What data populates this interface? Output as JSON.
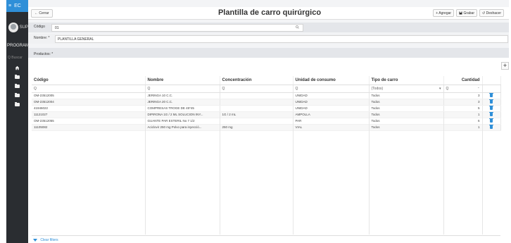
{
  "sidebar": {
    "menu_glyph": "≡",
    "brand": "EC",
    "user_name": "SUP",
    "program": "PROGRAM",
    "search_placeholder": "Q Buscar",
    "home_icon": "home-icon",
    "folder_icon": "folder-icon"
  },
  "header": {
    "back_label": "← Cerrar",
    "title": "Plantilla de carro quirúrgico",
    "add_label": "+ Agregar",
    "save_label": "Grabar",
    "undo_label": "Deshacer"
  },
  "form": {
    "code_label": "Código",
    "code_value": "01",
    "name_label": "Nombre: *",
    "name_value": "PLANTILLA GENERAL",
    "products_label": "Productos: *"
  },
  "grid": {
    "add_button": "+",
    "columns": [
      "Código",
      "Nombre",
      "Concentración",
      "Unidad de consumo",
      "Tipo de carro",
      "Cantidad"
    ],
    "filter": {
      "search_glyph": "Q",
      "tipo_value": "(Todos)",
      "tipo_caret": "▾",
      "spin_glyph": "⌃"
    },
    "rows": [
      {
        "codigo": "OM-23512005",
        "nombre": "JERINGA 10 C.C.",
        "concentracion": "",
        "unidad": "UNIDAD",
        "tipo": "Todos",
        "cantidad": "3"
      },
      {
        "codigo": "OM-23512004",
        "nombre": "JERINGA 20 C.C.",
        "concentracion": "",
        "unidad": "UNIDAD",
        "tipo": "Todos",
        "cantidad": "3"
      },
      {
        "codigo": "41946022",
        "nombre": "COMPRESAS TROGE DE 45*45",
        "concentracion": "",
        "unidad": "UNIDAD",
        "tipo": "Todos",
        "cantidad": "5"
      },
      {
        "codigo": "11121027",
        "nombre": "DIPIRONA 1G / 2 ML SOLUCION INY...",
        "concentracion": "1G / 2 mL",
        "unidad": "AMPOLLA",
        "tipo": "Todos",
        "cantidad": "1"
      },
      {
        "codigo": "OM-23512055",
        "nombre": "GUANTE PAR ESTERIL No 7 1/2",
        "concentracion": "",
        "unidad": "PAR",
        "tipo": "Todos",
        "cantidad": "6"
      },
      {
        "codigo": "11105082",
        "nombre": "Aciclovir 250 mg Polvo para inyecció...",
        "concentracion": "250 mg",
        "unidad": "VIAL",
        "tipo": "Todos",
        "cantidad": "1"
      }
    ],
    "clear_filters": "Clear filters"
  },
  "colors": {
    "accent": "#2f8fd8",
    "sidebar_bg": "#2a2d31"
  }
}
